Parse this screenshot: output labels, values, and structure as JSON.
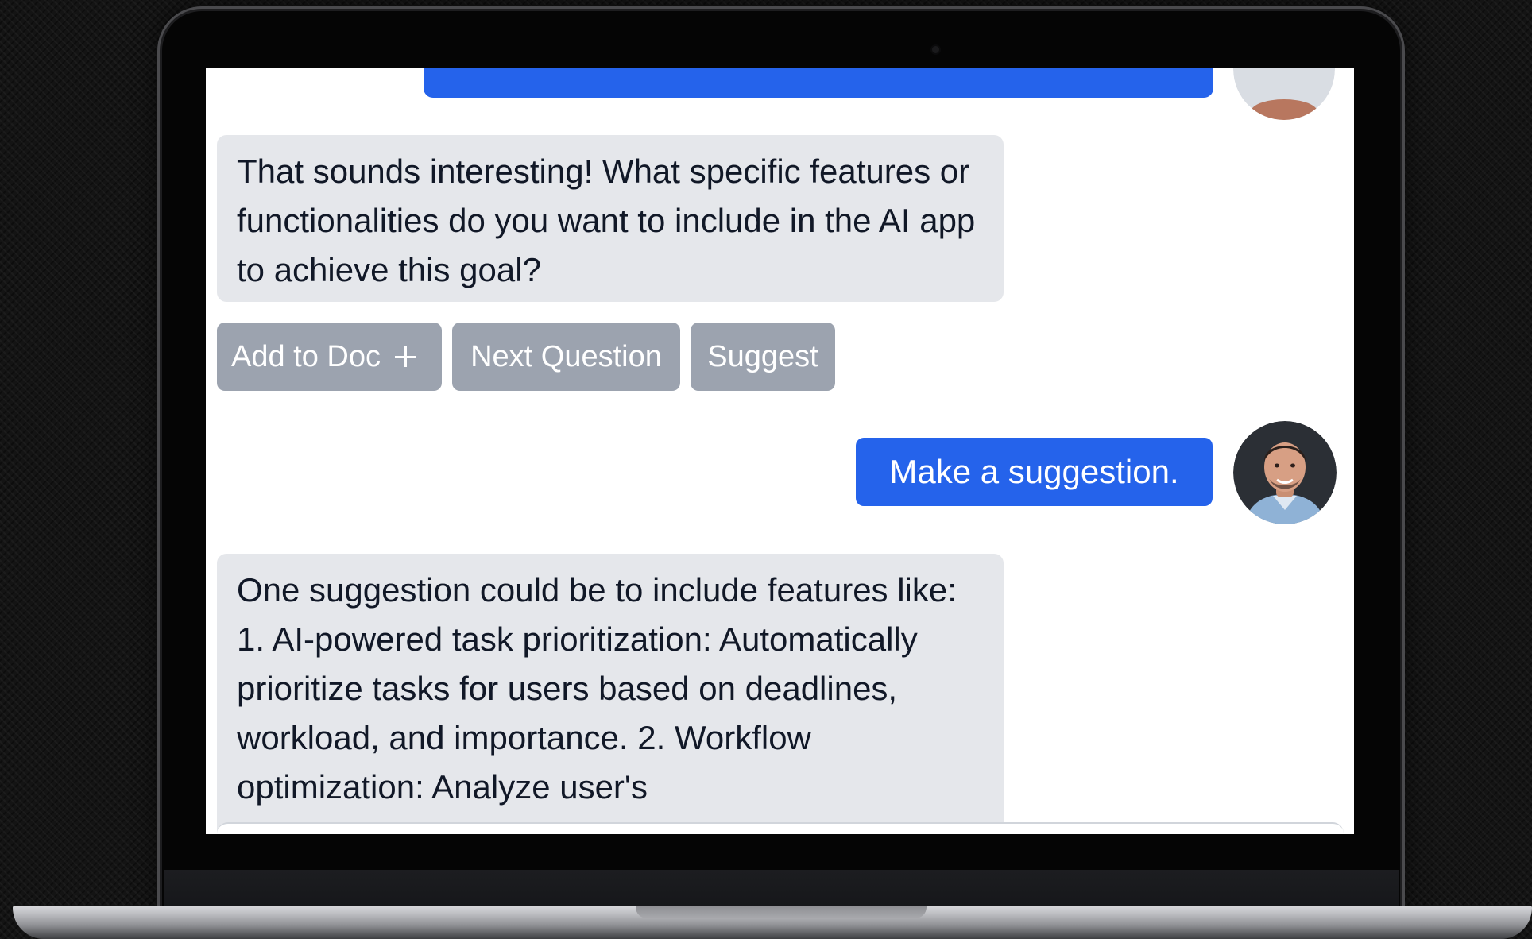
{
  "chat": {
    "messages": [
      {
        "role": "assistant",
        "text": "That sounds interesting! What specific features or functionalities do you want to include in the AI app to achieve this goal?"
      },
      {
        "role": "user",
        "text": "Make a suggestion."
      },
      {
        "role": "assistant",
        "text": "One suggestion could be to include features like: 1. AI-powered task prioritization: Automatically prioritize tasks for users based on deadlines, workload, and importance. 2. Workflow optimization: Analyze user's"
      }
    ],
    "actions": {
      "add_to_doc": "Add to Doc",
      "next_question": "Next Question",
      "suggest": "Suggest"
    }
  },
  "icons": {
    "add": "plus-icon",
    "avatar": "user-avatar"
  },
  "colors": {
    "user_bubble": "#2563eb",
    "assistant_bubble": "#e5e7eb",
    "action_button": "#9ca3af",
    "screen_background": "#ffffff"
  }
}
